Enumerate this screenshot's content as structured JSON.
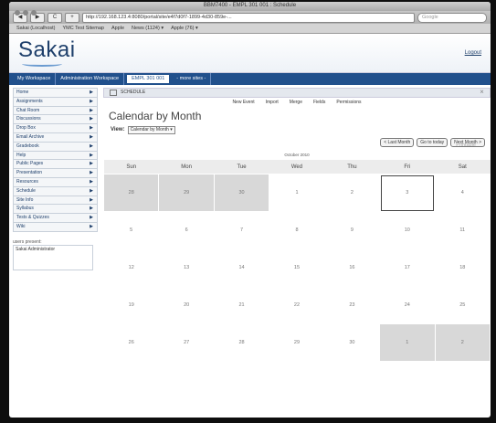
{
  "window": {
    "title": "BBM7400 - EMPL 301 001 : Schedule"
  },
  "toolbar": {
    "back": "◀",
    "forward": "▶",
    "reload": "C",
    "add": "+",
    "url": "http://192.168.123.4:8080/portal/site/e4f7d0f7-1899-4d30-859e-...",
    "search_placeholder": "Google"
  },
  "bookmarks": [
    "Sakai (Localhost)",
    "YMC Test Sitemap",
    "Apple",
    "News (1124) ▾",
    "Apple (76) ▾"
  ],
  "header": {
    "logo": "Sakai",
    "logout": "Logout"
  },
  "sitenav": {
    "tabs": [
      {
        "label": "My Workspace",
        "active": false
      },
      {
        "label": "Administration Workspace",
        "active": false
      },
      {
        "label": "EMPL 301 001",
        "active": true
      },
      {
        "label": "- more sites -",
        "active": false
      }
    ]
  },
  "leftnav": {
    "items": [
      "Home",
      "Assignments",
      "Chat Room",
      "Discussions",
      "Drop Box",
      "Email Archive",
      "Gradebook",
      "Help",
      "Public Pages",
      "Presentation",
      "Resources",
      "Schedule",
      "Site Info",
      "Syllabus",
      "Tests & Quizzes",
      "Wiki"
    ],
    "arrow": "▶",
    "presence_title": "users present:",
    "presence_user": "Sakai Administrator"
  },
  "portlet": {
    "title": "SCHEDULE",
    "close": "⨯"
  },
  "actions": [
    "New Event",
    "Import",
    "Merge",
    "Fields",
    "Permissions"
  ],
  "page": {
    "title": "Calendar by Month",
    "view_label": "View:",
    "view_value": "Calendar by Month ▾",
    "print": "Printable"
  },
  "nav": {
    "prev": "< Last Month",
    "today": "Go to today",
    "next": "Next Month >"
  },
  "week_of": "October 2010",
  "calendar": {
    "days": [
      "Sun",
      "Mon",
      "Tue",
      "Wed",
      "Thu",
      "Fri",
      "Sat"
    ],
    "weeks": [
      [
        {
          "d": "28",
          "other": true
        },
        {
          "d": "29",
          "other": true
        },
        {
          "d": "30",
          "other": true
        },
        {
          "d": "1",
          "other": false
        },
        {
          "d": "2",
          "other": false
        },
        {
          "d": "3",
          "other": false,
          "today": true
        },
        {
          "d": "4",
          "other": false
        }
      ],
      [
        {
          "d": "5",
          "other": false
        },
        {
          "d": "6",
          "other": false
        },
        {
          "d": "7",
          "other": false
        },
        {
          "d": "8",
          "other": false
        },
        {
          "d": "9",
          "other": false
        },
        {
          "d": "10",
          "other": false
        },
        {
          "d": "11",
          "other": false
        }
      ],
      [
        {
          "d": "12",
          "other": false
        },
        {
          "d": "13",
          "other": false
        },
        {
          "d": "14",
          "other": false
        },
        {
          "d": "15",
          "other": false
        },
        {
          "d": "16",
          "other": false
        },
        {
          "d": "17",
          "other": false
        },
        {
          "d": "18",
          "other": false
        }
      ],
      [
        {
          "d": "19",
          "other": false
        },
        {
          "d": "20",
          "other": false
        },
        {
          "d": "21",
          "other": false
        },
        {
          "d": "22",
          "other": false
        },
        {
          "d": "23",
          "other": false
        },
        {
          "d": "24",
          "other": false
        },
        {
          "d": "25",
          "other": false
        }
      ],
      [
        {
          "d": "26",
          "other": false
        },
        {
          "d": "27",
          "other": false
        },
        {
          "d": "28",
          "other": false
        },
        {
          "d": "29",
          "other": false
        },
        {
          "d": "30",
          "other": false
        },
        {
          "d": "1",
          "other": true
        },
        {
          "d": "2",
          "other": true
        }
      ]
    ]
  },
  "colors": {
    "brand": "#21508c",
    "other_month": "#d8d8d8"
  }
}
